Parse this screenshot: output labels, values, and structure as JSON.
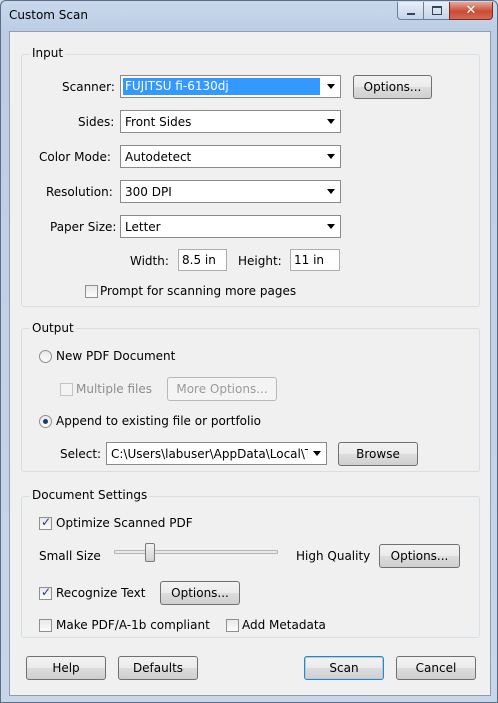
{
  "window": {
    "title": "Custom Scan",
    "close_glyph": "✕"
  },
  "input": {
    "legend": "Input",
    "scanner_label": "Scanner:",
    "scanner_value": "FUJITSU fi-6130dj",
    "scanner_options": "Options...",
    "sides_label": "Sides:",
    "sides_value": "Front Sides",
    "color_mode_label": "Color Mode:",
    "color_mode_value": "Autodetect",
    "resolution_label": "Resolution:",
    "resolution_value": "300 DPI",
    "paper_size_label": "Paper Size:",
    "paper_size_value": "Letter",
    "width_label": "Width:",
    "width_value": "8.5 in",
    "height_label": "Height:",
    "height_value": "11 in",
    "prompt_label": "Prompt for scanning more pages",
    "prompt_checked": false
  },
  "output": {
    "legend": "Output",
    "new_pdf_label": "New PDF Document",
    "multiple_files_label": "Multiple files",
    "more_options_label": "More Options...",
    "append_label": "Append to existing file or portfolio",
    "select_label": "Select:",
    "select_value": "C:\\Users\\labuser\\AppData\\Local\\Ten",
    "browse_label": "Browse"
  },
  "document_settings": {
    "legend": "Document Settings",
    "optimize_label": "Optimize Scanned PDF",
    "small_size_label": "Small Size",
    "high_quality_label": "High Quality",
    "quality_options": "Options...",
    "quality_level": 0.2,
    "recognize_label": "Recognize Text",
    "recognize_options": "Options...",
    "pdfa_label": "Make PDF/A-1b compliant",
    "metadata_label": "Add Metadata"
  },
  "footer": {
    "help": "Help",
    "defaults": "Defaults",
    "scan": "Scan",
    "cancel": "Cancel"
  },
  "colors": {
    "selection": "#3399ff",
    "window_frame": "#bccde4",
    "dialog_bg": "#f0f0f0"
  }
}
